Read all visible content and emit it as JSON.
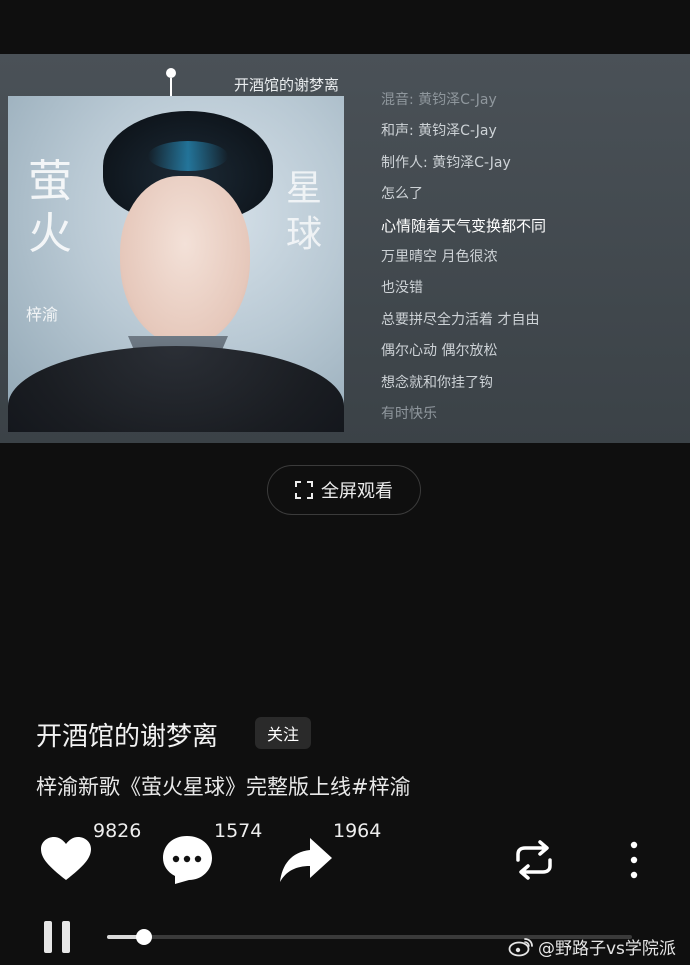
{
  "video": {
    "title": "开酒馆的谢梦离",
    "cover": {
      "song_title_left": "萤火",
      "song_title_right": "星球",
      "artist": "梓渝"
    },
    "lyrics": [
      {
        "text": "混音: 黄钧泽C-Jay",
        "state": "dim"
      },
      {
        "text": "和声: 黄钧泽C-Jay",
        "state": "normal"
      },
      {
        "text": "制作人: 黄钧泽C-Jay",
        "state": "normal"
      },
      {
        "text": "怎么了",
        "state": "normal"
      },
      {
        "text": "心情随着天气变换都不同",
        "state": "active"
      },
      {
        "text": "万里晴空 月色很浓",
        "state": "normal"
      },
      {
        "text": "也没错",
        "state": "normal"
      },
      {
        "text": "总要拼尽全力活着 才自由",
        "state": "normal"
      },
      {
        "text": "偶尔心动 偶尔放松",
        "state": "normal"
      },
      {
        "text": "想念就和你挂了钩",
        "state": "normal"
      },
      {
        "text": "有时快乐",
        "state": "dim"
      }
    ],
    "fullscreen_label": "全屏观看"
  },
  "post": {
    "author": "开酒馆的谢梦离",
    "follow_label": "关注",
    "caption": "梓渝新歌《萤火星球》完整版上线#梓渝"
  },
  "actions": {
    "like": {
      "icon": "heart-icon",
      "count": "9826"
    },
    "comment": {
      "icon": "comment-icon",
      "count": "1574"
    },
    "share": {
      "icon": "share-icon",
      "count": "1964"
    },
    "loop_icon": "loop-icon",
    "more_icon": "more-vertical-icon"
  },
  "player": {
    "state": "playing",
    "progress": 0.07
  },
  "watermark": {
    "text": "@野路子vs学院派",
    "icon": "weibo-icon"
  }
}
